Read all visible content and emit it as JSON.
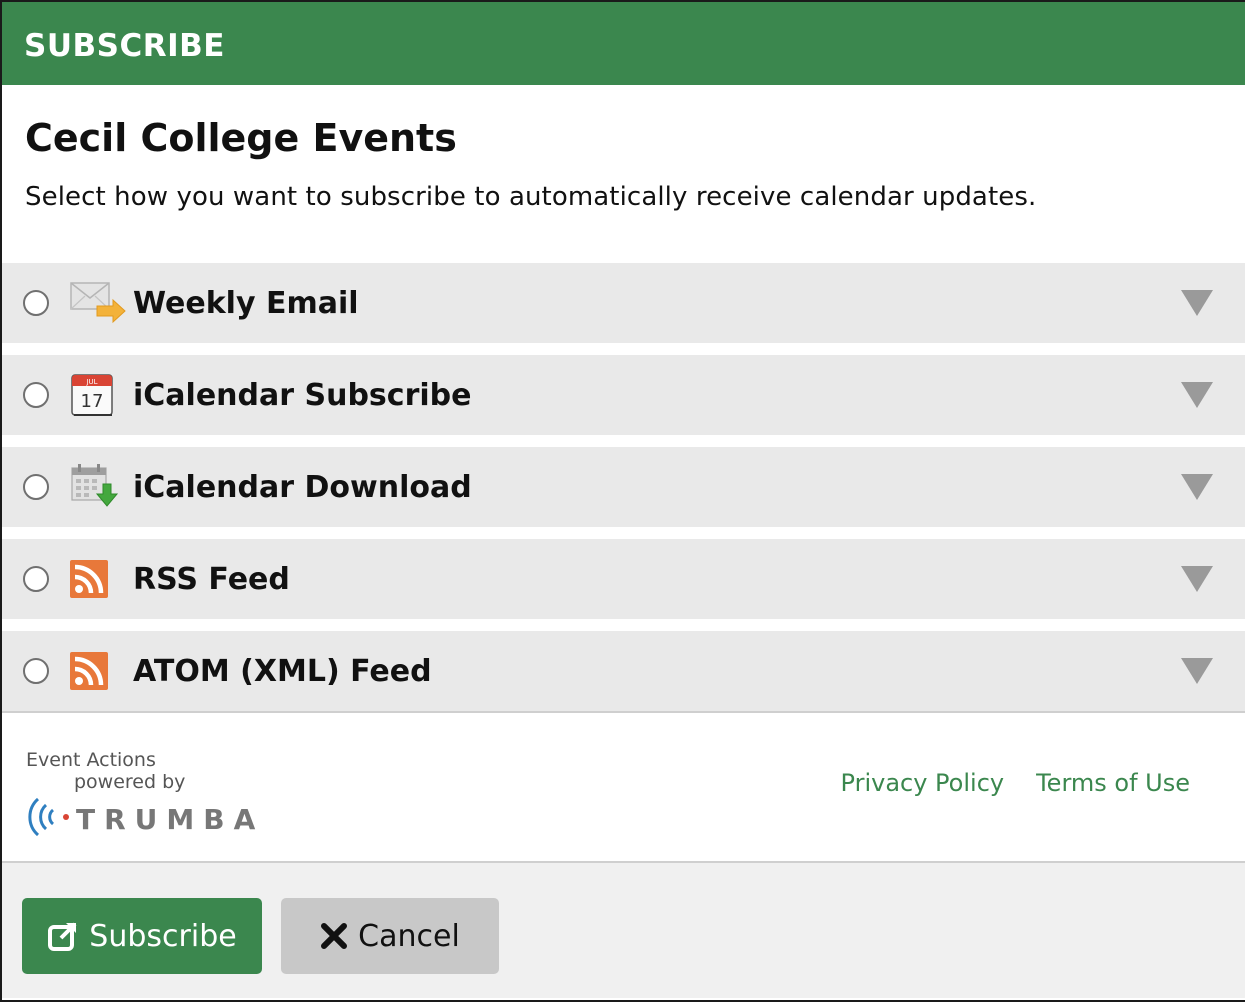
{
  "header": {
    "title": "SUBSCRIBE"
  },
  "calendar": {
    "name": "Cecil College Events",
    "instructions": "Select how you want to subscribe to automatically receive calendar updates."
  },
  "options": [
    {
      "label": "Weekly Email",
      "icon": "email-arrow-icon",
      "selected": false
    },
    {
      "label": "iCalendar Subscribe",
      "icon": "calendar-date-icon",
      "icon_month": "JUL",
      "icon_day": "17",
      "selected": false
    },
    {
      "label": "iCalendar Download",
      "icon": "calendar-download-icon",
      "selected": false
    },
    {
      "label": "RSS Feed",
      "icon": "rss-icon",
      "selected": false
    },
    {
      "label": "ATOM (XML) Feed",
      "icon": "rss-icon",
      "selected": false
    }
  ],
  "footer": {
    "event_actions": "Event Actions",
    "powered_by": "powered by",
    "brand": "TRUMBA",
    "privacy_link": "Privacy Policy",
    "terms_link": "Terms of Use"
  },
  "buttons": {
    "subscribe": "Subscribe",
    "cancel": "Cancel"
  },
  "colors": {
    "accent_green": "#3b874e",
    "option_bg": "#e9e9e9",
    "rss_orange": "#e8783a",
    "cancel_bg": "#c8c8c8"
  }
}
